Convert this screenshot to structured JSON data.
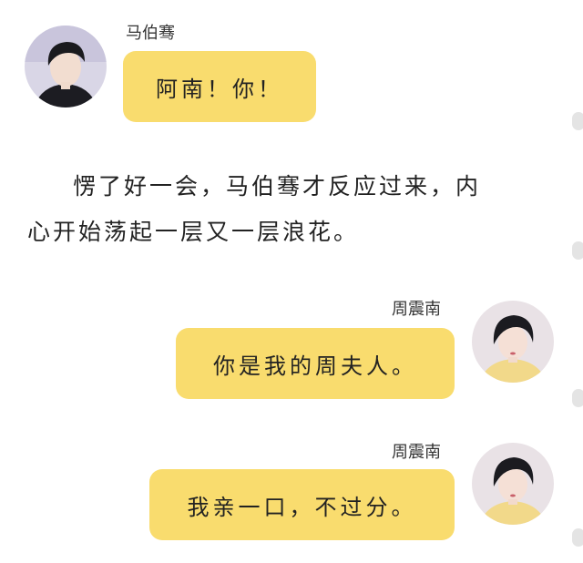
{
  "messages": [
    {
      "sender": "马伯骞",
      "text": "阿南！你！"
    },
    {
      "sender": "周震南",
      "text": "你是我的周夫人。"
    },
    {
      "sender": "周震南",
      "text": "我亲一口，不过分。"
    }
  ],
  "narration": {
    "line1": "愣了好一会，马伯骞才反应过来，内",
    "line2": "心开始荡起一层又一层浪花。"
  },
  "colors": {
    "bubble": "#f9dc6e",
    "background": "#ffffff"
  },
  "icons": {
    "avatar_left": "avatar-ma-boqian",
    "avatar_right": "avatar-zhou-zhennan"
  }
}
